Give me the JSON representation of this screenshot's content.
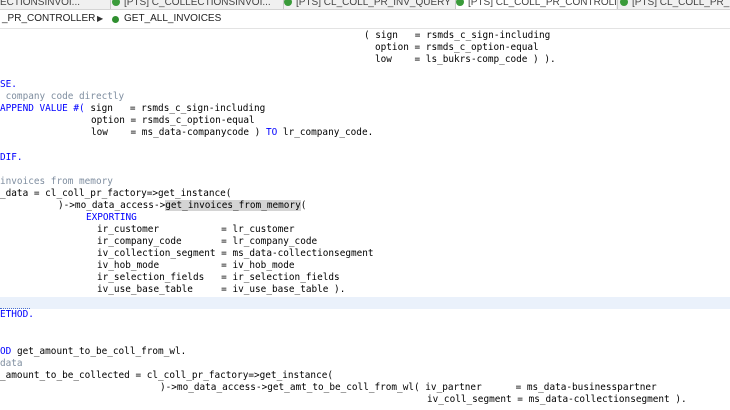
{
  "tabs": [
    {
      "label": "ECTIONSINVOI...",
      "active": false
    },
    {
      "label": "[PTS] C_COLLECTIONSINVOI...",
      "active": false
    },
    {
      "label": "[PTS] CL_COLL_PR_INV_QUERY",
      "active": false
    },
    {
      "label": "[PTS] CL_COLL_PR_CONTROLL...",
      "active": true
    },
    {
      "label": "[PTS] CL_COLL_PR_DAT...",
      "active": false
    }
  ],
  "breadcrumb": {
    "class": "_PR_CONTROLLER",
    "method": "GET_ALL_INVOICES"
  },
  "code": {
    "l1": "( sign   = rsmds_c_sign-including",
    "l2": "option = rsmds_c_option-equal",
    "l3": "low    = ls_bukrs-comp_code ) ).",
    "l4": "SE.",
    "l5": " company code directly",
    "l6a": "APPEND VALUE #(",
    "l6b": " sign   = rsmds_c_sign-including",
    "l7": "option = rsmds_c_option-equal",
    "l8a": "low    = ms_data-companycode ) ",
    "l8b": "TO",
    "l8c": " lr_company_code.",
    "l9": "DIF.",
    "l10": "invoices from memory",
    "l11a": "_data = cl_coll_pr_factory=>get_instance(",
    "l12a": ")->mo_data_access->",
    "l12b": "get_invoices_from_memory",
    "l12c": "(",
    "l13": "EXPORTING",
    "l14": "ir_customer           = lr_customer",
    "l15": "ir_company_code       = lr_company_code",
    "l16": "iv_collection_segment = ms_data-collectionsegment",
    "l17": "iv_hob_mode           = iv_hob_mode",
    "l18": "ir_selection_fields   = ir_selection_fields",
    "l19": "iv_use_base_table     = iv_use_base_table ).",
    "l20": "ETHOD.",
    "l21a": "OD",
    "l21b": " get_amount_to_be_coll_from_wl.",
    "l22": "data",
    "l23": "_amount_to_be_collected = cl_coll_pr_factory=>get_instance(",
    "l24": ")->mo_data_access->get_amt_to_be_coll_from_wl( iv_partner      = ms_data-businesspartner",
    "l25": "iv_coll_segment = ms_data-collectionsegment )."
  },
  "colors": {
    "keyword": "#0000ff",
    "comment": "#7f8ea0",
    "highlight": "#d4d4d4",
    "current_line": "#eaf1fb"
  }
}
